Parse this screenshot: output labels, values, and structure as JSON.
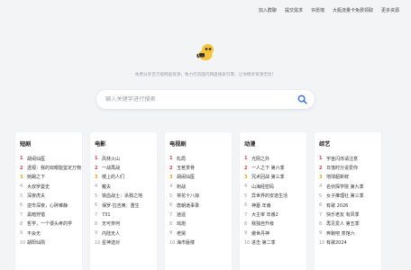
{
  "topnav": [
    "加入群聊",
    "提交需求",
    "许愿墙",
    "大瓶流量卡免费领取",
    "更多资源"
  ],
  "tagline": "免费分享百万级网盘资源，致力打造国内网盘搜索引擎，让你畅享资源无忧！",
  "search": {
    "placeholder": "输入关键字进行搜索",
    "icon": "search-icon"
  },
  "colors": {
    "accent": "#2f6fe0",
    "top_rank": "#e53935",
    "third_rank": "#f39c12"
  },
  "categories": [
    {
      "title": "短剧",
      "items": [
        {
          "n": "1",
          "t": "胡闹仙医"
        },
        {
          "n": "2",
          "t": "透视：我的双眼能鉴定万物"
        },
        {
          "n": "3",
          "t": "她踢之下"
        },
        {
          "n": "4",
          "t": "大叔罗曼史"
        },
        {
          "n": "5",
          "t": "深夜虎夫"
        },
        {
          "n": "6",
          "t": "逆市深夜，心碎难静"
        },
        {
          "n": "7",
          "t": "黑暗狩猎"
        },
        {
          "n": "8",
          "t": "哲学，一个很头疼的学"
        },
        {
          "n": "9",
          "t": "不会无"
        },
        {
          "n": "10",
          "t": "胡阳仙陨"
        }
      ]
    },
    {
      "title": "电影",
      "items": [
        {
          "n": "1",
          "t": "风林火山"
        },
        {
          "n": "2",
          "t": "一战再战"
        },
        {
          "n": "3",
          "t": "楼上的人们"
        },
        {
          "n": "4",
          "t": "戴夫"
        },
        {
          "n": "5",
          "t": "铁血战士：杀戮之地"
        },
        {
          "n": "6",
          "t": "保罗·拉吉奥：重生"
        },
        {
          "n": "7",
          "t": "731"
        },
        {
          "n": "8",
          "t": "无可奈何"
        },
        {
          "n": "9",
          "t": "内陆无人"
        },
        {
          "n": "10",
          "t": "星神送对"
        }
      ]
    },
    {
      "title": "电视剧",
      "items": [
        {
          "n": "1",
          "t": "轧局"
        },
        {
          "n": "2",
          "t": "玉茗茶骨"
        },
        {
          "n": "3",
          "t": "胡闹仙医"
        },
        {
          "n": "4",
          "t": "刺战"
        },
        {
          "n": "5",
          "t": "将花十八掠"
        },
        {
          "n": "6",
          "t": "唐朝诡事录"
        },
        {
          "n": "7",
          "t": "逍遥"
        },
        {
          "n": "8",
          "t": "戏炮"
        },
        {
          "n": "9",
          "t": "老舅"
        },
        {
          "n": "10",
          "t": "海市蜃楼"
        }
      ]
    },
    {
      "title": "动漫",
      "items": [
        {
          "n": "1",
          "t": "光阴之外"
        },
        {
          "n": "2",
          "t": "一人之下 第六季"
        },
        {
          "n": "3",
          "t": "咒术回战 第三季"
        },
        {
          "n": "4",
          "t": "山海经密码"
        },
        {
          "n": "5",
          "t": "异世界的安逸生活"
        },
        {
          "n": "6",
          "t": "神墓 年番"
        },
        {
          "n": "7",
          "t": "大主宰 年番2"
        },
        {
          "n": "8",
          "t": "我独自升级"
        },
        {
          "n": "9",
          "t": "傲世丹神"
        },
        {
          "n": "10",
          "t": "进击 第二季"
        }
      ]
    },
    {
      "title": "综艺",
      "items": [
        {
          "n": "1",
          "t": "宇宙闪烁请注意"
        },
        {
          "n": "2",
          "t": "日落时分说爱你"
        },
        {
          "n": "3",
          "t": "地球超新鲜"
        },
        {
          "n": "4",
          "t": "名侦探学院 第九季"
        },
        {
          "n": "5",
          "t": "女子推理社 第三季"
        },
        {
          "n": "6",
          "t": "有歌 2026"
        },
        {
          "n": "7",
          "t": "快乐老友 有风季"
        },
        {
          "n": "8",
          "t": "再见爱人 第五季"
        },
        {
          "n": "9",
          "t": "奔跑吧 茶馆六"
        },
        {
          "n": "10",
          "t": "有歌2024"
        }
      ]
    }
  ]
}
